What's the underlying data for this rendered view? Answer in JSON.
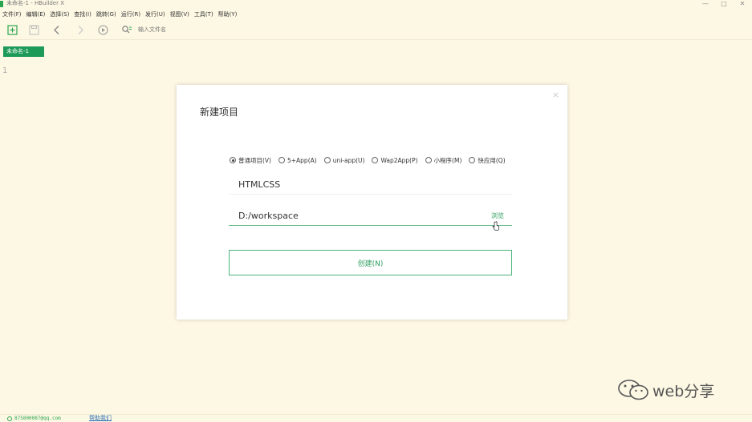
{
  "window": {
    "title": "未命名-1 - HBuilder X",
    "controls": [
      "—",
      "□",
      "✕"
    ]
  },
  "menu": [
    "文件(F)",
    "编辑(E)",
    "选择(S)",
    "查找(I)",
    "跳转(G)",
    "运行(R)",
    "发行(U)",
    "视图(V)",
    "工具(T)",
    "帮助(Y)"
  ],
  "toolbar": {
    "icons": [
      "new-file-icon",
      "save-icon",
      "back-icon",
      "forward-icon",
      "run-icon",
      "search-file-icon"
    ],
    "search_placeholder": "输入文件名"
  },
  "editor": {
    "tab_label": "未命名-1",
    "line_number": "1"
  },
  "dialog": {
    "title": "新建项目",
    "close": "×",
    "project_types": [
      {
        "label": "普通项目(V)",
        "checked": true
      },
      {
        "label": "5+App(A)",
        "checked": false
      },
      {
        "label": "uni-app(U)",
        "checked": false
      },
      {
        "label": "Wap2App(P)",
        "checked": false
      },
      {
        "label": "小程序(M)",
        "checked": false
      },
      {
        "label": "快应用(Q)",
        "checked": false
      }
    ],
    "project_name": "HTMLCSS",
    "location": "D:/workspace",
    "browse_label": "浏览",
    "create_label": "创建(N)"
  },
  "watermark": {
    "text": "web分享"
  },
  "status": {
    "account": "875800087@qq.com",
    "help": "帮助我们"
  },
  "colors": {
    "accent": "#2c9e5c",
    "background": "#fdf8e4"
  }
}
